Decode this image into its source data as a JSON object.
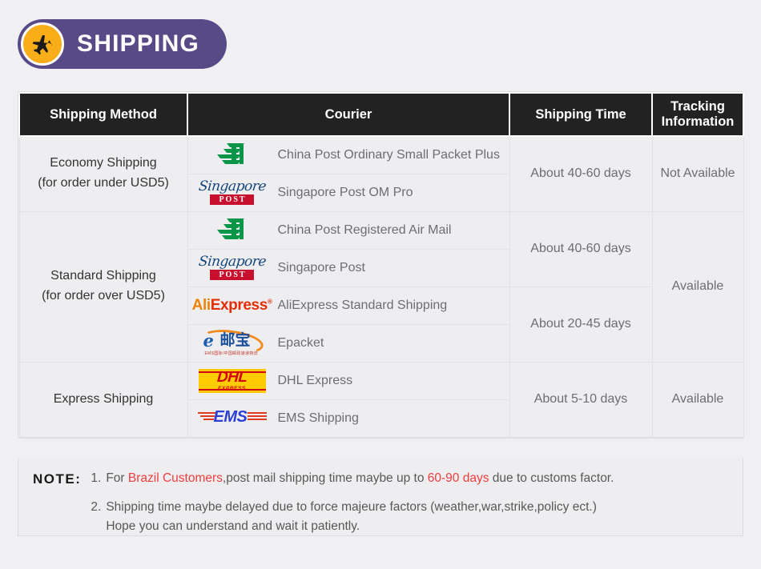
{
  "banner": {
    "title": "SHIPPING",
    "icon": "airplane-icon",
    "background_color": "#584a86",
    "icon_background_color": "#f9ae19"
  },
  "table": {
    "headers": {
      "method": "Shipping Method",
      "courier": "Courier",
      "time": "Shipping Time",
      "tracking": "Tracking Information"
    },
    "groups": [
      {
        "method_line1": "Economy Shipping",
        "method_line2": "(for order under USD5)",
        "tracking": "Not Available",
        "rows": [
          {
            "logo": "china-post-logo",
            "name": "China Post Ordinary Small Packet Plus"
          },
          {
            "logo": "singapore-post-logo",
            "name": "Singapore Post OM Pro"
          }
        ],
        "times": [
          {
            "label": "About 40-60 days",
            "span": 2
          }
        ]
      },
      {
        "method_line1": "Standard Shipping",
        "method_line2": "(for order over USD5)",
        "tracking": "Available",
        "rows": [
          {
            "logo": "china-post-logo",
            "name": "China Post Registered Air Mail"
          },
          {
            "logo": "singapore-post-logo",
            "name": "Singapore Post"
          },
          {
            "logo": "aliexpress-logo",
            "name": "AliExpress Standard Shipping"
          },
          {
            "logo": "epacket-logo",
            "name": "Epacket"
          }
        ],
        "times": [
          {
            "label": "About 40-60 days",
            "span": 2
          },
          {
            "label": "About 20-45 days",
            "span": 2
          }
        ]
      },
      {
        "method_line1": "Express Shipping",
        "method_line2": "",
        "tracking": "Available",
        "rows": [
          {
            "logo": "dhl-logo",
            "name": "DHL Express"
          },
          {
            "logo": "ems-logo",
            "name": "EMS Shipping"
          }
        ],
        "times": [
          {
            "label": "About 5-10 days",
            "span": 2
          }
        ]
      }
    ]
  },
  "note": {
    "label": "NOTE:",
    "items": [
      {
        "number": "1.",
        "segments": [
          {
            "text": "For ",
            "highlight": false
          },
          {
            "text": "Brazil Customers",
            "highlight": true
          },
          {
            "text": ",post mail shipping time maybe up to ",
            "highlight": false
          },
          {
            "text": "60-90 days",
            "highlight": true
          },
          {
            "text": " due to customs factor.",
            "highlight": false
          }
        ]
      },
      {
        "number": "2.",
        "line1": "Shipping time maybe delayed due to force majeure factors (weather,war,strike,policy ect.)",
        "line2": "Hope you can understand and wait it patiently."
      }
    ],
    "highlight_color": "#ef3d3d"
  },
  "logo_text": {
    "singapore_script": "Singapore",
    "singapore_post": "POST",
    "aliexpress_ali": "Ali",
    "aliexpress_express": "Express",
    "epacket_e": "e",
    "epacket_cn": "邮宝",
    "epacket_sub": "EMS国际/中国邮政速递物流",
    "dhl": "DHL",
    "dhl_sub": "EXPRESS",
    "ems": "EMS"
  }
}
